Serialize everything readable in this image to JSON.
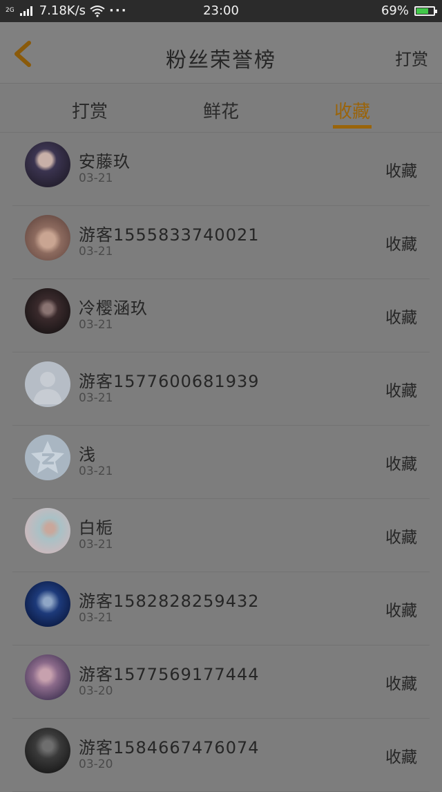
{
  "status_bar": {
    "network": "2G",
    "speed": "7.18K/s",
    "time": "23:00",
    "battery": "69%",
    "battery_level": 0.69,
    "battery_color": "#42c84a"
  },
  "header": {
    "title": "粉丝荣誉榜",
    "action_label": "打赏",
    "back_icon": "chevron-left-icon",
    "accent_color": "#9a640a"
  },
  "tabs": [
    {
      "label": "打赏",
      "active": false
    },
    {
      "label": "鲜花",
      "active": false
    },
    {
      "label": "收藏",
      "active": true
    }
  ],
  "fans": [
    {
      "name": "安藤玖",
      "date": "03-21",
      "action": "收藏",
      "avatar": "anime-girl-avatar"
    },
    {
      "name": "游客1555833740021",
      "date": "03-21",
      "action": "收藏",
      "avatar": "cat-avatar"
    },
    {
      "name": "冷樱涵玖",
      "date": "03-21",
      "action": "收藏",
      "avatar": "anime-dark-avatar"
    },
    {
      "name": "游客1577600681939",
      "date": "03-21",
      "action": "收藏",
      "avatar": "default-person-avatar"
    },
    {
      "name": "浅",
      "date": "03-21",
      "action": "收藏",
      "avatar": "qq-star-avatar"
    },
    {
      "name": "白栀",
      "date": "03-21",
      "action": "收藏",
      "avatar": "pastel-girl-avatar"
    },
    {
      "name": "游客1582828259432",
      "date": "03-21",
      "action": "收藏",
      "avatar": "blue-anime-avatar"
    },
    {
      "name": "游客1577569177444",
      "date": "03-20",
      "action": "收藏",
      "avatar": "pink-anime-avatar"
    },
    {
      "name": "游客1584667476074",
      "date": "03-20",
      "action": "收藏",
      "avatar": "monochrome-avatar"
    }
  ]
}
